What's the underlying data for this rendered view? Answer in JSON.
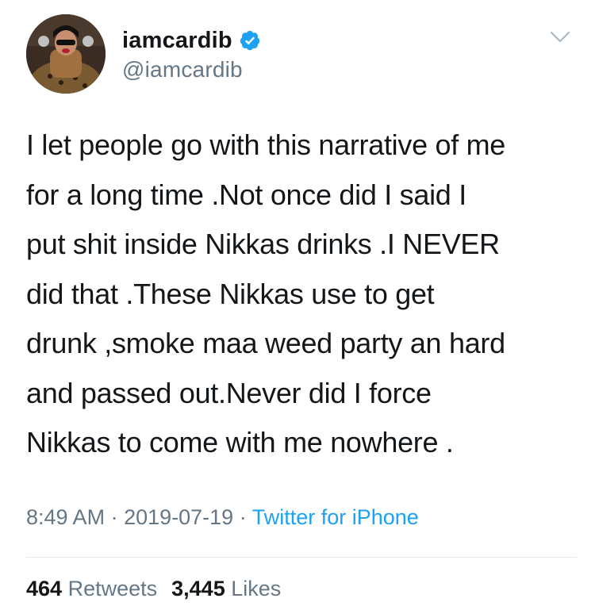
{
  "user": {
    "display_name": "iamcardib",
    "handle": "@iamcardib",
    "verified": true
  },
  "icons": {
    "verified": "verified-badge-icon",
    "menu": "chevron-down-icon"
  },
  "tweet": {
    "lines": [
      "I let people go with this narrative of me",
      "for a long time .Not once did I said I",
      "put shit inside Nikkas drinks .I NEVER",
      "did that .These Nikkas use to get",
      "drunk ,smoke maa weed party an hard",
      "and passed out.Never did I force",
      "Nikkas to come with me nowhere ."
    ]
  },
  "meta": {
    "time": "8:49 AM",
    "separator": " · ",
    "date": "2019-07-19",
    "source": "Twitter for iPhone"
  },
  "stats": {
    "retweets_count": "464",
    "retweets_label": "Retweets",
    "likes_count": "3,445",
    "likes_label": "Likes"
  },
  "colors": {
    "text": "#14171a",
    "secondary": "#657786",
    "accent": "#1da1f2",
    "divider": "#e1e8ed"
  }
}
